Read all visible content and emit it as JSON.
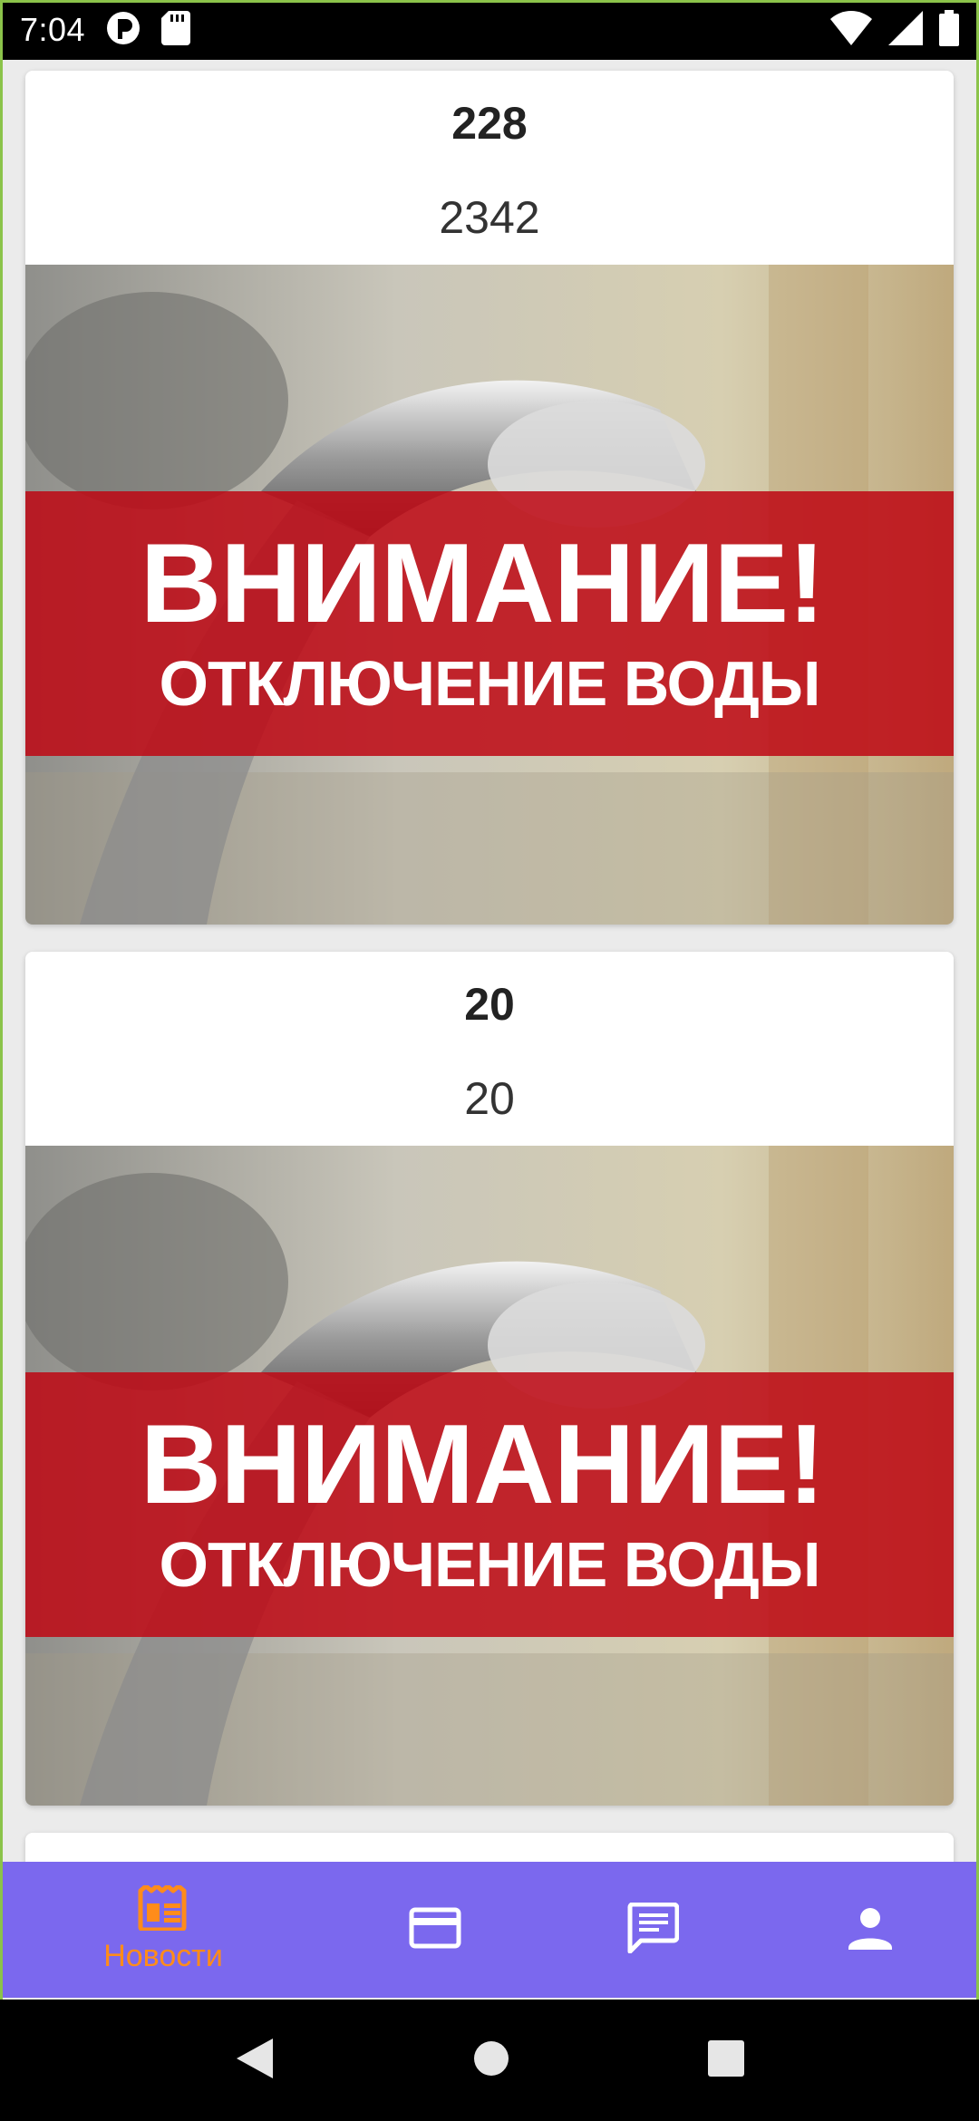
{
  "status_bar": {
    "time": "7:04"
  },
  "feed": {
    "items": [
      {
        "title": "228",
        "subtitle": "2342",
        "banner_title": "ВНИМАНИЕ!",
        "banner_subtitle": "ОТКЛЮЧЕНИЕ ВОДЫ"
      },
      {
        "title": "20",
        "subtitle": "20",
        "banner_title": "ВНИМАНИЕ!",
        "banner_subtitle": "ОТКЛЮЧЕНИЕ ВОДЫ"
      }
    ]
  },
  "bottom_nav": {
    "items": [
      {
        "icon": "newspaper-icon",
        "label": "Новости",
        "active": true
      },
      {
        "icon": "credit-card-icon",
        "label": "",
        "active": false
      },
      {
        "icon": "message-icon",
        "label": "",
        "active": false
      },
      {
        "icon": "person-icon",
        "label": "",
        "active": false
      }
    ],
    "colors": {
      "background": "#7b68ee",
      "active": "#ff8c1a",
      "inactive": "#ffffff"
    }
  },
  "colors": {
    "banner_red": "#be0814",
    "accent_border": "#8bc34a"
  }
}
